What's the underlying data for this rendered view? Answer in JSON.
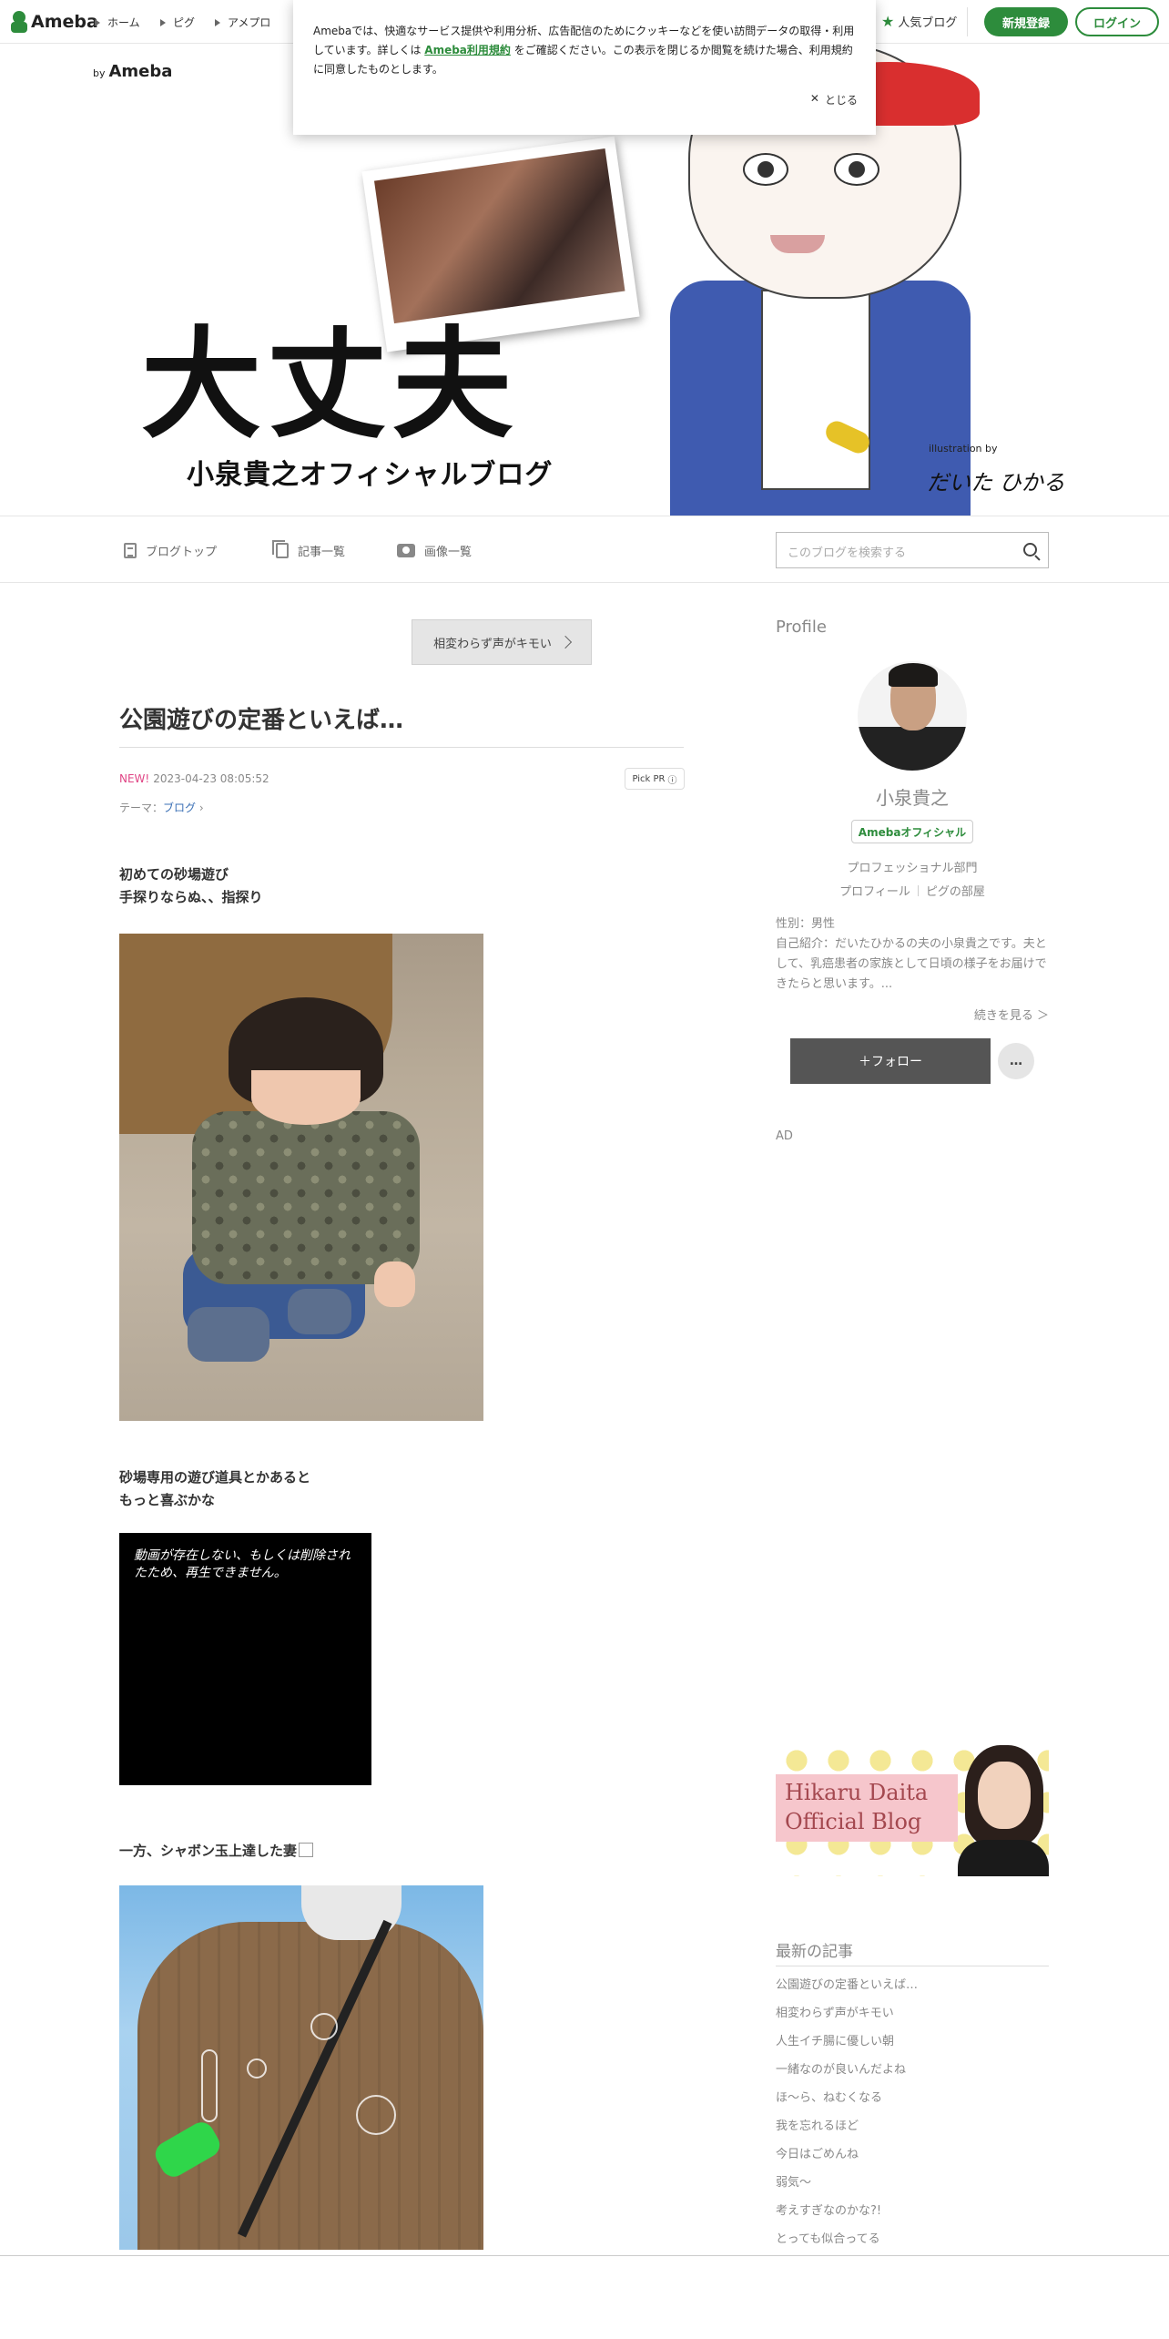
{
  "topbar": {
    "logo": "Ameba",
    "nav": [
      "ホーム",
      "ピグ",
      "アメプロ"
    ],
    "popular": "人気ブログ",
    "signup": "新規登録",
    "login": "ログイン"
  },
  "cookie": {
    "text_before": "Amebaでは、快適なサービス提供や利用分析、広告配信のためにクッキーなどを使い訪問データの取得・利用しています。詳しくは",
    "link": "Ameba利用規約",
    "text_after": "をご確認ください。この表示を閉じるか閲覧を続けた場合、利用規約に同意したものとします。",
    "close": "とじる"
  },
  "header": {
    "by": "by",
    "by_brand": "Ameba",
    "title": "大丈夫",
    "subtitle": "小泉貴之オフィシャルブログ",
    "illustration_by": "illustration by",
    "signature": "だいた ひかる"
  },
  "blognav": {
    "items": [
      "ブログトップ",
      "記事一覧",
      "画像一覧"
    ],
    "search_placeholder": "このブログを検索する"
  },
  "entry": {
    "prev_link": "相変わらず声がキモい",
    "title": "公園遊びの定番といえば…",
    "new_label": "NEW!",
    "date": "2023-04-23 08:05:52",
    "pickpr": "Pick PR",
    "theme_label": "テーマ：",
    "theme": "ブログ",
    "para1_line1": "初めての砂場遊び",
    "para1_line2": "手探りならぬ、、指探り",
    "para2_line1": "砂場専用の遊び道具とかあると",
    "para2_line2": "もっと喜ぶかな",
    "video_message": "動画が存在しない、もしくは削除されたため、再生できません。",
    "para3": "一方、シャボン玉上達した妻"
  },
  "sidebar": {
    "profile_heading": "Profile",
    "name": "小泉貴之",
    "badge": "Amebaオフィシャル",
    "category": "プロフェッショナル部門",
    "link1": "プロフィール",
    "link2": "ピグの部屋",
    "gender": "性別：男性",
    "intro": "自己紹介：だいたひかるの夫の小泉貴之です。夫として、乳癌患者の家族として日頃の様子をお届けできたらと思います。...",
    "more": "続きを見る ＞",
    "follow": "＋フォロー",
    "more_button": "…",
    "ad": "AD",
    "banner_line1": "Hikaru Daita",
    "banner_line2": "Official Blog",
    "recent_heading": "最新の記事",
    "recent": [
      "公園遊びの定番といえば…",
      "相変わらず声がキモい",
      "人生イチ腸に優しい朝",
      "一緒なのが良いんだよね",
      "ほ〜ら、ねむくなる",
      "我を忘れるほど",
      "今日はごめんね",
      "弱気〜",
      "考えすぎなのかな?!",
      "とっても似合ってる"
    ]
  },
  "colors": {
    "brand_green": "#2d8c3c",
    "new_pink": "#e04585",
    "follow_bg": "#555555"
  }
}
